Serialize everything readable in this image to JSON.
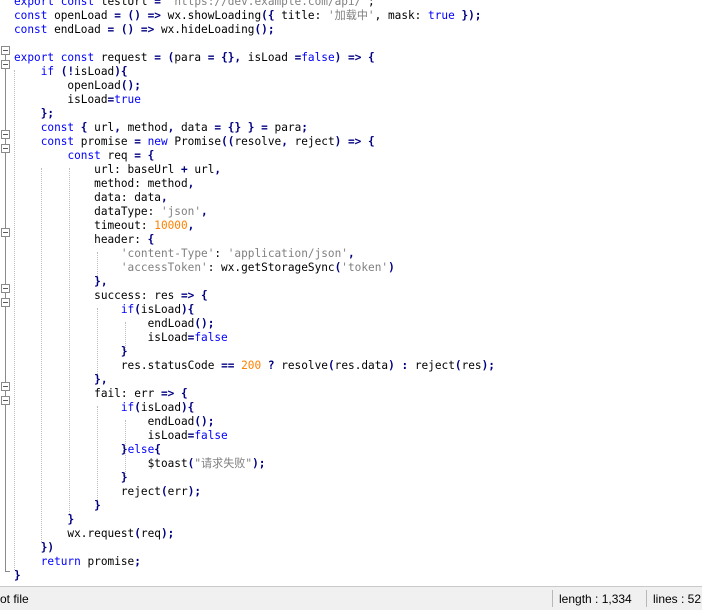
{
  "editor": {
    "lines": [
      [
        [
          "kw",
          "export const "
        ],
        [
          "t",
          "testUrl"
        ],
        [
          "op",
          " = "
        ],
        [
          "str",
          "'https://dev.example.com/api/'"
        ],
        [
          "t",
          ";"
        ]
      ],
      [
        [
          "kw",
          "const "
        ],
        [
          "t",
          "openLoad "
        ],
        [
          "op",
          "= () => "
        ],
        [
          "t",
          "wx.showLoading"
        ],
        [
          "op",
          "({ "
        ],
        [
          "t",
          "title: "
        ],
        [
          "str",
          "'加载中'"
        ],
        [
          "t",
          ", mask: "
        ],
        [
          "kw",
          "true"
        ],
        [
          "op",
          " });"
        ]
      ],
      [
        [
          "kw",
          "const "
        ],
        [
          "t",
          "endLoad "
        ],
        [
          "op",
          "= () => "
        ],
        [
          "t",
          "wx.hideLoading"
        ],
        [
          "op",
          "();"
        ]
      ],
      [],
      [
        [
          "kw",
          "export const "
        ],
        [
          "t",
          "request "
        ],
        [
          "op",
          "= ("
        ],
        [
          "t",
          "para "
        ],
        [
          "op",
          "= {}, "
        ],
        [
          "t",
          "isLoad "
        ],
        [
          "op",
          "="
        ],
        [
          "kw",
          "false"
        ],
        [
          "op",
          ") => {"
        ]
      ],
      [
        [
          "t",
          "    "
        ],
        [
          "kw",
          "if "
        ],
        [
          "op",
          "(!"
        ],
        [
          "t",
          "isLoad"
        ],
        [
          "op",
          "){"
        ]
      ],
      [
        [
          "t",
          "        openLoad"
        ],
        [
          "op",
          "();"
        ]
      ],
      [
        [
          "t",
          "        isLoad"
        ],
        [
          "op",
          "="
        ],
        [
          "kw",
          "true"
        ]
      ],
      [
        [
          "t",
          "    "
        ],
        [
          "op",
          "};"
        ]
      ],
      [
        [
          "t",
          "    "
        ],
        [
          "kw",
          "const "
        ],
        [
          "op",
          "{ "
        ],
        [
          "t",
          "url"
        ],
        [
          "op",
          ", "
        ],
        [
          "t",
          "method"
        ],
        [
          "op",
          ", "
        ],
        [
          "t",
          "data "
        ],
        [
          "op",
          "= {} } = "
        ],
        [
          "t",
          "para"
        ],
        [
          "op",
          ";"
        ]
      ],
      [
        [
          "t",
          "    "
        ],
        [
          "kw",
          "const "
        ],
        [
          "t",
          "promise "
        ],
        [
          "op",
          "= "
        ],
        [
          "kw",
          "new "
        ],
        [
          "t",
          "Promise"
        ],
        [
          "op",
          "(("
        ],
        [
          "t",
          "resolve"
        ],
        [
          "op",
          ", "
        ],
        [
          "t",
          "reject"
        ],
        [
          "op",
          ") => {"
        ]
      ],
      [
        [
          "t",
          "        "
        ],
        [
          "kw",
          "const "
        ],
        [
          "t",
          "req "
        ],
        [
          "op",
          "= {"
        ]
      ],
      [
        [
          "t",
          "            url: baseUrl "
        ],
        [
          "op",
          "+ "
        ],
        [
          "t",
          "url"
        ],
        [
          "op",
          ","
        ]
      ],
      [
        [
          "t",
          "            method: method"
        ],
        [
          "op",
          ","
        ]
      ],
      [
        [
          "t",
          "            data: data"
        ],
        [
          "op",
          ","
        ]
      ],
      [
        [
          "t",
          "            dataType: "
        ],
        [
          "str",
          "'json'"
        ],
        [
          "op",
          ","
        ]
      ],
      [
        [
          "t",
          "            timeout: "
        ],
        [
          "num",
          "10000"
        ],
        [
          "op",
          ","
        ]
      ],
      [
        [
          "t",
          "            header: "
        ],
        [
          "op",
          "{"
        ]
      ],
      [
        [
          "t",
          "                "
        ],
        [
          "str",
          "'content-Type'"
        ],
        [
          "t",
          ": "
        ],
        [
          "str",
          "'application/json'"
        ],
        [
          "op",
          ","
        ]
      ],
      [
        [
          "t",
          "                "
        ],
        [
          "str",
          "'accessToken'"
        ],
        [
          "t",
          ": wx.getStorageSync"
        ],
        [
          "op",
          "("
        ],
        [
          "str",
          "'token'"
        ],
        [
          "op",
          ")"
        ]
      ],
      [
        [
          "t",
          "            "
        ],
        [
          "op",
          "},"
        ]
      ],
      [
        [
          "t",
          "            success: res "
        ],
        [
          "op",
          "=> {"
        ]
      ],
      [
        [
          "t",
          "                "
        ],
        [
          "kw",
          "if"
        ],
        [
          "op",
          "("
        ],
        [
          "t",
          "isLoad"
        ],
        [
          "op",
          "){"
        ]
      ],
      [
        [
          "t",
          "                    endLoad"
        ],
        [
          "op",
          "();"
        ]
      ],
      [
        [
          "t",
          "                    isLoad"
        ],
        [
          "op",
          "="
        ],
        [
          "kw",
          "false"
        ]
      ],
      [
        [
          "t",
          "                "
        ],
        [
          "op",
          "}"
        ]
      ],
      [
        [
          "t",
          "                res.statusCode "
        ],
        [
          "op",
          "== "
        ],
        [
          "num",
          "200"
        ],
        [
          "op",
          " ? "
        ],
        [
          "t",
          "resolve"
        ],
        [
          "op",
          "("
        ],
        [
          "t",
          "res.data"
        ],
        [
          "op",
          ") : "
        ],
        [
          "t",
          "reject"
        ],
        [
          "op",
          "("
        ],
        [
          "t",
          "res"
        ],
        [
          "op",
          ");"
        ]
      ],
      [
        [
          "t",
          "            "
        ],
        [
          "op",
          "},"
        ]
      ],
      [
        [
          "t",
          "            fail: err "
        ],
        [
          "op",
          "=> {"
        ]
      ],
      [
        [
          "t",
          "                "
        ],
        [
          "kw",
          "if"
        ],
        [
          "op",
          "("
        ],
        [
          "t",
          "isLoad"
        ],
        [
          "op",
          "){"
        ]
      ],
      [
        [
          "t",
          "                    endLoad"
        ],
        [
          "op",
          "();"
        ]
      ],
      [
        [
          "t",
          "                    isLoad"
        ],
        [
          "op",
          "="
        ],
        [
          "kw",
          "false"
        ]
      ],
      [
        [
          "t",
          "                "
        ],
        [
          "op",
          "}"
        ],
        [
          "kw",
          "else"
        ],
        [
          "op",
          "{"
        ]
      ],
      [
        [
          "t",
          "                    $toast"
        ],
        [
          "op",
          "("
        ],
        [
          "str",
          "\"请求失败\""
        ],
        [
          "op",
          ");"
        ]
      ],
      [
        [
          "t",
          "                "
        ],
        [
          "op",
          "}"
        ]
      ],
      [
        [
          "t",
          "                reject"
        ],
        [
          "op",
          "("
        ],
        [
          "t",
          "err"
        ],
        [
          "op",
          ");"
        ]
      ],
      [
        [
          "t",
          "            "
        ],
        [
          "op",
          "}"
        ]
      ],
      [
        [
          "t",
          "        "
        ],
        [
          "op",
          "}"
        ]
      ],
      [
        [
          "t",
          "        wx.request"
        ],
        [
          "op",
          "("
        ],
        [
          "t",
          "req"
        ],
        [
          "op",
          ");"
        ]
      ],
      [
        [
          "t",
          "    "
        ],
        [
          "op",
          "})"
        ]
      ],
      [
        [
          "t",
          "    "
        ],
        [
          "kw",
          "return "
        ],
        [
          "t",
          "promise"
        ],
        [
          "op",
          ";"
        ]
      ],
      [
        [
          "op",
          "}"
        ]
      ]
    ]
  },
  "statusbar": {
    "left_text": "ot file",
    "length_text": "length : 1,334",
    "lines_text": "lines : 52"
  }
}
